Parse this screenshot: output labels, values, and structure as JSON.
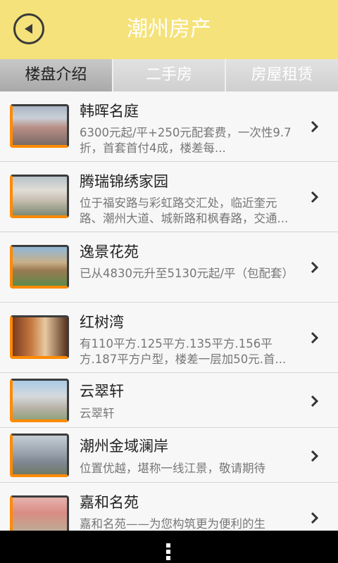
{
  "header": {
    "title": "潮州房产"
  },
  "tabs": [
    {
      "label": "楼盘介绍",
      "active": true
    },
    {
      "label": "二手房",
      "active": false
    },
    {
      "label": "房屋租赁",
      "active": false
    }
  ],
  "listings": [
    {
      "title": "韩晖名庭",
      "description": "6300元起/平+250元配套费，一次性9.7折，首套首付4成，楼差每..."
    },
    {
      "title": "腾瑞锦绣家园",
      "description": "位于福安路与彩虹路交汇处，临近奎元路、潮州大道、城新路和枫春路，交通..."
    },
    {
      "title": "逸景花苑",
      "description": "已从4830元升至5130元起/平（包配套）"
    },
    {
      "title": "红树湾",
      "description": "有110平方.125平方.135平方.156平方.187平方户型，楼差一层加50元.首..."
    },
    {
      "title": "云翠轩",
      "description": "云翠轩"
    },
    {
      "title": "潮州金域澜岸",
      "description": "位置优越，堪称一线江景，敬请期待"
    },
    {
      "title": "嘉和名苑",
      "description": "嘉和名苑——为您构筑更为便利的生"
    }
  ],
  "colors": {
    "header_bg": "#f5e27a",
    "accent": "#ff8a00"
  }
}
